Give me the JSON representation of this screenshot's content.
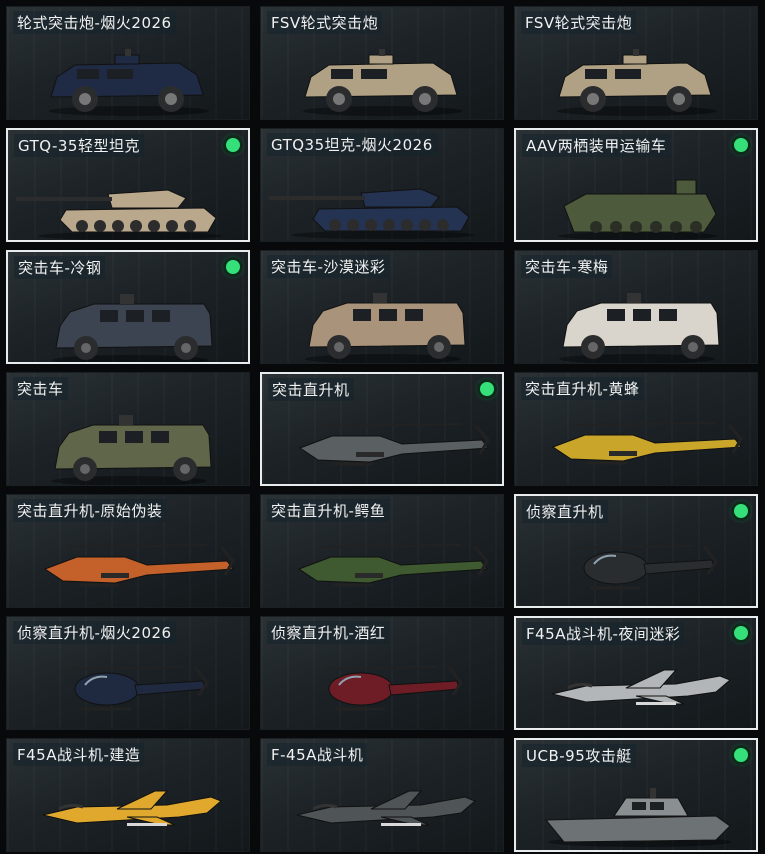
{
  "items": [
    {
      "name": "轮式突击炮-烟火2026",
      "kind": "apc",
      "color": "#1f2b45",
      "owned": false,
      "selected": false
    },
    {
      "name": "FSV轮式突击炮",
      "kind": "apc",
      "color": "#b0a184",
      "owned": false,
      "selected": false
    },
    {
      "name": "FSV轮式突击炮",
      "kind": "apc",
      "color": "#b0a184",
      "owned": false,
      "selected": false
    },
    {
      "name": "GTQ-35轻型坦克",
      "kind": "tank",
      "color": "#b9a88c",
      "owned": true,
      "selected": true
    },
    {
      "name": "GTQ35坦克-烟火2026",
      "kind": "tank",
      "color": "#243352",
      "owned": false,
      "selected": false
    },
    {
      "name": "AAV两栖装甲运输车",
      "kind": "amphib",
      "color": "#4e5a3c",
      "owned": true,
      "selected": true
    },
    {
      "name": "突击车-冷钢",
      "kind": "truck",
      "color": "#3b4450",
      "owned": true,
      "selected": true
    },
    {
      "name": "突击车-沙漠迷彩",
      "kind": "truck",
      "color": "#a9937a",
      "owned": false,
      "selected": false
    },
    {
      "name": "突击车-寒梅",
      "kind": "truck",
      "color": "#d9d4cc",
      "owned": false,
      "selected": false
    },
    {
      "name": "突击车",
      "kind": "truck",
      "color": "#5f664a",
      "owned": false,
      "selected": false
    },
    {
      "name": "突击直升机",
      "kind": "heli",
      "color": "#5a5f62",
      "owned": true,
      "selected": true
    },
    {
      "name": "突击直升机-黄蜂",
      "kind": "heli",
      "color": "#c9a52a",
      "owned": false,
      "selected": false
    },
    {
      "name": "突击直升机-原始伪装",
      "kind": "heli",
      "color": "#c4602a",
      "owned": false,
      "selected": false
    },
    {
      "name": "突击直升机-鳄鱼",
      "kind": "heli",
      "color": "#3f5a30",
      "owned": false,
      "selected": false
    },
    {
      "name": "侦察直升机",
      "kind": "scout",
      "color": "#2a2d30",
      "owned": true,
      "selected": true
    },
    {
      "name": "侦察直升机-烟火2026",
      "kind": "scout",
      "color": "#1f2a40",
      "owned": false,
      "selected": false
    },
    {
      "name": "侦察直升机-酒红",
      "kind": "scout",
      "color": "#6e1d26",
      "owned": false,
      "selected": false
    },
    {
      "name": "F45A战斗机-夜间迷彩",
      "kind": "jet",
      "color": "#b3b6b8",
      "owned": true,
      "selected": true
    },
    {
      "name": "F45A战斗机-建造",
      "kind": "jet",
      "color": "#e0a92e",
      "owned": false,
      "selected": false
    },
    {
      "name": "F-45A战斗机",
      "kind": "jet",
      "color": "#4f5457",
      "owned": false,
      "selected": false
    },
    {
      "name": "UCB-95攻击艇",
      "kind": "boat",
      "color": "#6d7275",
      "owned": true,
      "selected": true
    }
  ]
}
